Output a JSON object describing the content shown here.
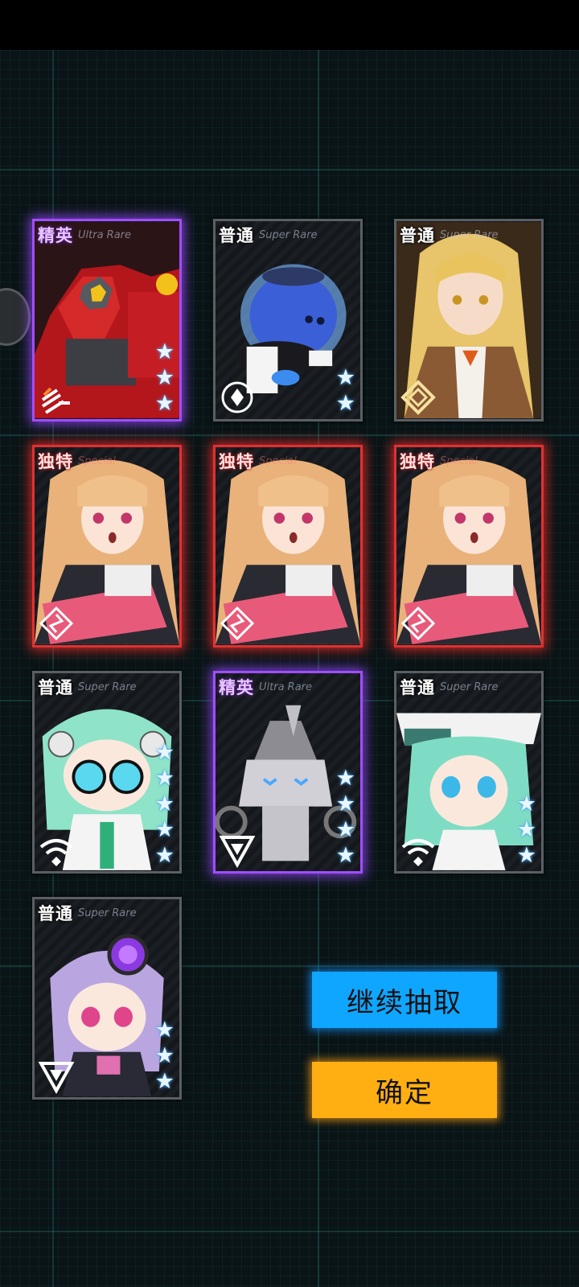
{
  "cards": [
    {
      "rarity": "精英",
      "grade": "Ultra Rare",
      "tier": "elite",
      "stars": 3,
      "character": "red-mech",
      "class_icon": "claw-marks-icon"
    },
    {
      "rarity": "普通",
      "grade": "Super Rare",
      "tier": "common",
      "stars": 2,
      "character": "blue-slime-robot",
      "class_icon": "target-ring-icon"
    },
    {
      "rarity": "普通",
      "grade": "Super Rare",
      "tier": "common",
      "stars": 0,
      "character": "blonde-girl",
      "class_icon": "diamond-emblem-icon"
    },
    {
      "rarity": "独特",
      "grade": "Special",
      "tier": "unique",
      "stars": 0,
      "character": "orange-haired-girl",
      "class_icon": "shuriken-emblem-icon"
    },
    {
      "rarity": "独特",
      "grade": "Special",
      "tier": "unique",
      "stars": 0,
      "character": "orange-haired-girl",
      "class_icon": "shuriken-emblem-icon"
    },
    {
      "rarity": "独特",
      "grade": "Special",
      "tier": "unique",
      "stars": 0,
      "character": "orange-haired-girl",
      "class_icon": "shuriken-emblem-icon"
    },
    {
      "rarity": "普通",
      "grade": "Super Rare",
      "tier": "common",
      "stars": 5,
      "character": "green-haired-chibi-glasses",
      "class_icon": "wifi-signal-icon"
    },
    {
      "rarity": "精英",
      "grade": "Ultra Rare",
      "tier": "elite",
      "stars": 4,
      "character": "box-head-robot",
      "class_icon": "triangle-emblem-icon"
    },
    {
      "rarity": "普通",
      "grade": "Super Rare",
      "tier": "common",
      "stars": 3,
      "character": "green-haired-chibi-hat",
      "class_icon": "wifi-signal-icon"
    },
    {
      "rarity": "普通",
      "grade": "Super Rare",
      "tier": "common",
      "stars": 3,
      "character": "purple-haired-chibi",
      "class_icon": "triangle-emblem-icon"
    }
  ],
  "buttons": {
    "continue_label": "继续抽取",
    "confirm_label": "确定"
  },
  "colors": {
    "elite_glow": "#a14dff",
    "unique_glow": "#e03131",
    "continue_button": "#0fa6ff",
    "confirm_button": "#ffaf12",
    "star": "#e8f6ff"
  }
}
